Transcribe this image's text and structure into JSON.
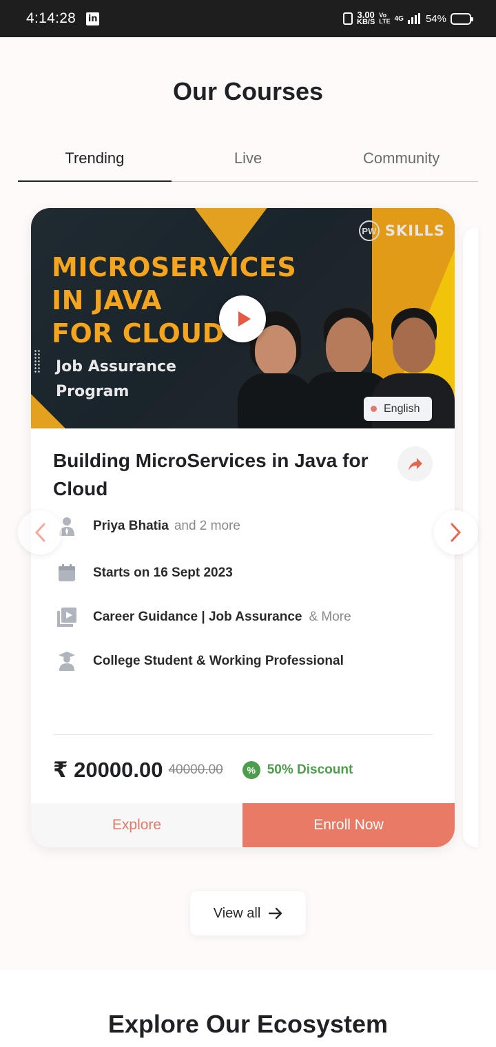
{
  "status_bar": {
    "time": "4:14:28",
    "app_icon": "linkedin-icon",
    "net_speed_value": "3.00",
    "net_speed_unit": "KB/S",
    "volte_top": "Vo",
    "volte_bottom": "LTE",
    "network": "4G",
    "battery_percent": "54%",
    "battery_level": 0.54
  },
  "page": {
    "title": "Our Courses"
  },
  "tabs": [
    {
      "label": "Trending",
      "active": true
    },
    {
      "label": "Live",
      "active": false
    },
    {
      "label": "Community",
      "active": false
    }
  ],
  "course": {
    "banner": {
      "line1": "MICROSERVICES",
      "line2": "IN JAVA",
      "line3": "FOR CLOUD",
      "sub1": "Job Assurance",
      "sub2": "Program",
      "brand_mark": "PW",
      "brand": "SKILLS"
    },
    "language": "English",
    "title": "Building MicroServices in Java for Cloud",
    "instructor": "Priya Bhatia",
    "instructor_more": "and 2 more",
    "start_date": "Starts on 16 Sept 2023",
    "features": "Career Guidance | Job Assurance",
    "features_more": "& More",
    "audience": "College Student & Working Professional",
    "price": "₹ 20000.00",
    "original_price": "40000.00",
    "discount_symbol": "%",
    "discount": "50% Discount",
    "explore_label": "Explore",
    "enroll_label": "Enroll Now"
  },
  "view_all_label": "View all",
  "ecosystem_title": "Explore Our Ecosystem",
  "colors": {
    "accent": "#e97b66",
    "discount_green": "#4e9d4e",
    "status_bar": "#1e1e1e",
    "banner_orange": "#f4a51d"
  }
}
